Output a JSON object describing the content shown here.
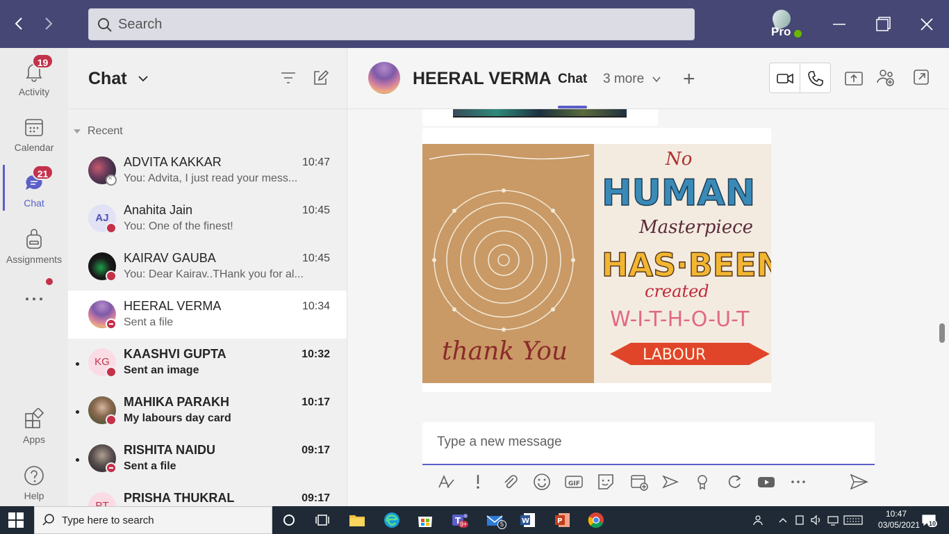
{
  "titlebar": {
    "search_placeholder": "Search",
    "profile_label": "Pro",
    "back_icon": "chevron-left-icon",
    "forward_icon": "chevron-right-icon"
  },
  "rail": {
    "items": [
      {
        "label": "Activity",
        "badge": "19",
        "icon": "bell-icon"
      },
      {
        "label": "Calendar",
        "icon": "calendar-icon"
      },
      {
        "label": "Chat",
        "badge": "21",
        "icon": "chat-icon",
        "active": true
      },
      {
        "label": "Assignments",
        "icon": "backpack-icon"
      },
      {
        "label": "More apps",
        "icon": "ellipsis-icon"
      },
      {
        "label": "Apps",
        "icon": "apps-icon"
      },
      {
        "label": "Help",
        "icon": "help-icon"
      }
    ],
    "more_glyph": "•••"
  },
  "chatlist": {
    "title": "Chat",
    "recent_label": "Recent",
    "chats": [
      {
        "name": "ADVITA KAKKAR",
        "time": "10:47",
        "preview": "You: Advita, I just read your mess...",
        "presence": "offline",
        "unread": false
      },
      {
        "name": "Anahita Jain",
        "initials": "AJ",
        "time": "10:45",
        "preview": "You: One of the finest!",
        "presence": "busy",
        "unread": false
      },
      {
        "name": "KAIRAV GAUBA",
        "time": "10:45",
        "preview": "You: Dear Kairav..THank you for al...",
        "presence": "busy",
        "unread": false
      },
      {
        "name": "HEERAL VERMA",
        "time": "10:34",
        "preview": "Sent a file",
        "presence": "dnd",
        "unread": false,
        "selected": true
      },
      {
        "name": "KAASHVI GUPTA",
        "initials": "KG",
        "time": "10:32",
        "preview": "Sent an image",
        "presence": "busy",
        "unread": true
      },
      {
        "name": "MAHIKA PARAKH",
        "time": "10:17",
        "preview": "My labours day card",
        "presence": "busy",
        "unread": true
      },
      {
        "name": "RISHITA NAIDU",
        "time": "09:17",
        "preview": "Sent a file",
        "presence": "dnd",
        "unread": true
      },
      {
        "name": "PRISHA THUKRAL",
        "initials": "PT",
        "time": "09:17",
        "preview": "",
        "presence": "busy",
        "unread": true
      }
    ]
  },
  "main": {
    "contact_name": "HEERAL VERMA",
    "tab_chat": "Chat",
    "tab_more": "3 more",
    "add_tab": "+",
    "card": {
      "left_text": "thank You",
      "lines": [
        "No",
        "HUMAN",
        "Masterpiece",
        "HAS·BEEN",
        "created",
        "W-I-T-H-O-U-T",
        "LABOUR"
      ]
    },
    "composer_placeholder": "Type a new message"
  },
  "taskbar": {
    "search_placeholder": "Type here to search",
    "time": "10:47",
    "date": "03/05/2021",
    "teams_badge": "9+",
    "mail_badge": "5",
    "notif_count": "10"
  },
  "colors": {
    "titlebar": "#464775",
    "accent": "#5b5fc7",
    "badge": "#c4314b",
    "taskbar": "#1f2a36"
  }
}
